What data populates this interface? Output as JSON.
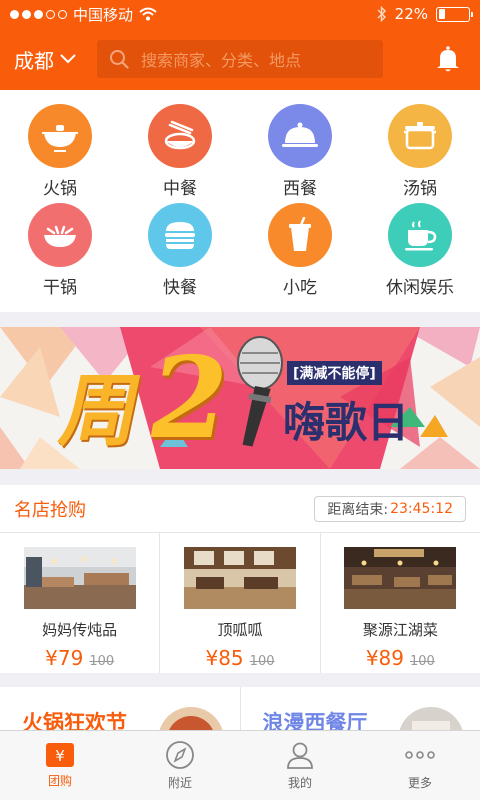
{
  "status_bar": {
    "carrier": "中国移动",
    "battery": "22%",
    "battery_level": 0.22
  },
  "header": {
    "city": "成都",
    "search_placeholder": "搜索商家、分类、地点"
  },
  "categories": [
    {
      "label": "火锅",
      "icon": "hotpot-icon",
      "color": "#f7892a"
    },
    {
      "label": "中餐",
      "icon": "chinese-food-icon",
      "color": "#ef6a44"
    },
    {
      "label": "西餐",
      "icon": "western-food-icon",
      "color": "#7b8ae8"
    },
    {
      "label": "汤锅",
      "icon": "soup-pot-icon",
      "color": "#f5b545"
    },
    {
      "label": "干锅",
      "icon": "dry-pot-icon",
      "color": "#f26f6f"
    },
    {
      "label": "快餐",
      "icon": "fast-food-icon",
      "color": "#5ec7ea"
    },
    {
      "label": "小吃",
      "icon": "snack-icon",
      "color": "#f88a2c"
    },
    {
      "label": "休闲娱乐",
      "icon": "leisure-icon",
      "color": "#3ecdb8"
    }
  ],
  "banner": {
    "tag": "[满减不能停]",
    "headline": "嗨歌日",
    "prefix": "周",
    "number": "2"
  },
  "flash_sale": {
    "title": "名店抢购",
    "countdown_label": "距离结束:",
    "countdown_time": "23:45:12",
    "shops": [
      {
        "name": "妈妈传炖品",
        "price": "¥79",
        "old_price": "100"
      },
      {
        "name": "顶呱呱",
        "price": "¥85",
        "old_price": "100"
      },
      {
        "name": "聚源江湖菜",
        "price": "¥89",
        "old_price": "100"
      }
    ]
  },
  "promos": [
    {
      "title": "火锅狂欢节",
      "color": "#f95d0c"
    },
    {
      "title": "浪漫西餐厅",
      "color": "#6f86e6"
    }
  ],
  "tabs": [
    {
      "label": "团购",
      "icon": "group-buy-icon",
      "active": true
    },
    {
      "label": "附近",
      "icon": "compass-icon",
      "active": false
    },
    {
      "label": "我的",
      "icon": "profile-icon",
      "active": false
    },
    {
      "label": "更多",
      "icon": "more-icon",
      "active": false
    }
  ],
  "colors": {
    "brand": "#f95d0c",
    "background": "#efeff4"
  }
}
